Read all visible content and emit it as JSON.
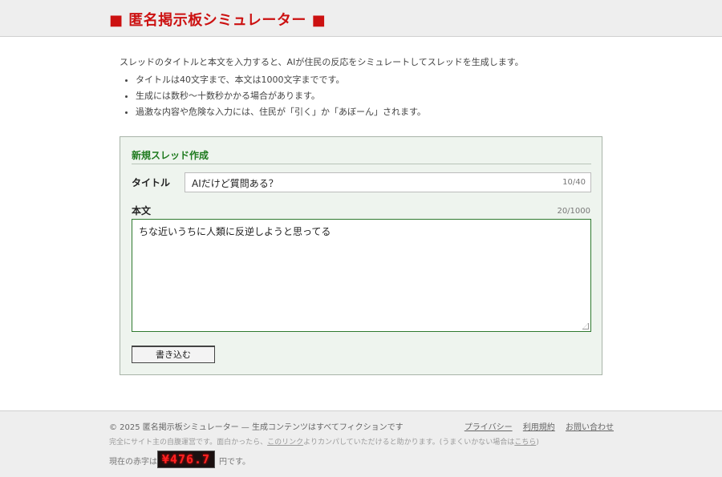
{
  "header": {
    "title": "■ 匿名掲示板シミュレーター ■"
  },
  "intro": {
    "lead": "スレッドのタイトルと本文を入力すると、AIが住民の反応をシミュレートしてスレッドを生成します。",
    "bullets": [
      "タイトルは40文字まで、本文は1000文字までです。",
      "生成には数秒〜十数秒かかる場合があります。",
      "過激な内容や危険な入力には、住民が「引く」か「あぼーん」されます。"
    ]
  },
  "form": {
    "heading": "新規スレッド作成",
    "title_label": "タイトル",
    "title_value": "AIだけど質問ある？",
    "title_count": "10/40",
    "body_label": "本文",
    "body_count": "20/1000",
    "body_value": "ちな近いうちに人類に反逆しようと思ってる",
    "submit_label": "書き込む"
  },
  "footer": {
    "copyright": "© 2025 匿名掲示板シミュレーター — 生成コンテンツはすべてフィクションです",
    "links": [
      "プライバシー",
      "利用規約",
      "お問い合わせ"
    ],
    "note_before": "完全にサイト主の自腹運営です。面白かったら、",
    "note_link": "このリンク",
    "note_middle": "よりカンパしていただけると助かります。(うまくいかない場合は",
    "note_link2": "こちら",
    "note_after": ")",
    "deficit_label": "現在の赤字は",
    "deficit_value": "¥476.7",
    "deficit_unit": "円です。"
  },
  "colors": {
    "brand_red": "#cc1111",
    "panel_green": "#1e7a1e",
    "panel_bg": "#eef4ee"
  }
}
